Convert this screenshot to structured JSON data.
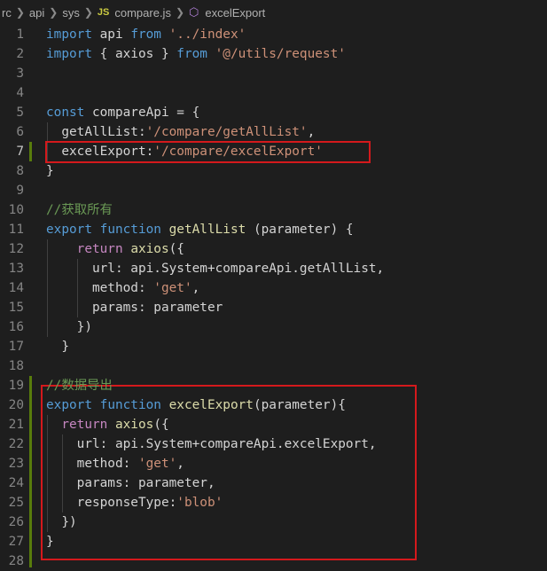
{
  "breadcrumb": {
    "items": [
      "rc",
      "api",
      "sys"
    ],
    "file_badge": "JS",
    "file": "compare.js",
    "symbol": "excelExport"
  },
  "editor": {
    "lines": [
      {
        "n": "1",
        "tokens": [
          [
            "k",
            "import"
          ],
          [
            "p",
            " api "
          ],
          [
            "k",
            "from"
          ],
          [
            "p",
            " "
          ],
          [
            "s",
            "'../index'"
          ]
        ]
      },
      {
        "n": "2",
        "tokens": [
          [
            "k",
            "import"
          ],
          [
            "p",
            " { axios } "
          ],
          [
            "k",
            "from"
          ],
          [
            "p",
            " "
          ],
          [
            "s",
            "'@/utils/request'"
          ]
        ]
      },
      {
        "n": "3",
        "tokens": []
      },
      {
        "n": "4",
        "tokens": []
      },
      {
        "n": "5",
        "tokens": [
          [
            "k",
            "const"
          ],
          [
            "p",
            " compareApi = {"
          ]
        ]
      },
      {
        "n": "6",
        "tokens": [
          [
            "p",
            "  getAllList:"
          ],
          [
            "s",
            "'/compare/getAllList'"
          ],
          [
            "p",
            ","
          ]
        ]
      },
      {
        "n": "7",
        "tokens": [
          [
            "p",
            "  excelExport:"
          ],
          [
            "s",
            "'/compare/excelExport'"
          ]
        ]
      },
      {
        "n": "8",
        "tokens": [
          [
            "p",
            "}"
          ]
        ]
      },
      {
        "n": "9",
        "tokens": []
      },
      {
        "n": "10",
        "tokens": [
          [
            "c",
            "//获取所有"
          ]
        ]
      },
      {
        "n": "11",
        "tokens": [
          [
            "k",
            "export"
          ],
          [
            "p",
            " "
          ],
          [
            "k",
            "function"
          ],
          [
            "p",
            " "
          ],
          [
            "f",
            "getAllList"
          ],
          [
            "p",
            " (parameter) {"
          ]
        ]
      },
      {
        "n": "12",
        "tokens": [
          [
            "p",
            "    "
          ],
          [
            "kc",
            "return"
          ],
          [
            "p",
            " "
          ],
          [
            "f",
            "axios"
          ],
          [
            "p",
            "({"
          ]
        ]
      },
      {
        "n": "13",
        "tokens": [
          [
            "p",
            "      url: api.System+compareApi.getAllList,"
          ]
        ]
      },
      {
        "n": "14",
        "tokens": [
          [
            "p",
            "      method: "
          ],
          [
            "s",
            "'get'"
          ],
          [
            "p",
            ","
          ]
        ]
      },
      {
        "n": "15",
        "tokens": [
          [
            "p",
            "      params: parameter"
          ]
        ]
      },
      {
        "n": "16",
        "tokens": [
          [
            "p",
            "    })"
          ]
        ]
      },
      {
        "n": "17",
        "tokens": [
          [
            "p",
            "  }"
          ]
        ]
      },
      {
        "n": "18",
        "tokens": []
      },
      {
        "n": "19",
        "tokens": [
          [
            "c",
            "//数据导出"
          ]
        ]
      },
      {
        "n": "20",
        "tokens": [
          [
            "k",
            "export"
          ],
          [
            "p",
            " "
          ],
          [
            "k",
            "function"
          ],
          [
            "p",
            " "
          ],
          [
            "f",
            "excelExport"
          ],
          [
            "p",
            "(parameter){"
          ]
        ]
      },
      {
        "n": "21",
        "tokens": [
          [
            "p",
            "  "
          ],
          [
            "kc",
            "return"
          ],
          [
            "p",
            " "
          ],
          [
            "f",
            "axios"
          ],
          [
            "p",
            "({"
          ]
        ]
      },
      {
        "n": "22",
        "tokens": [
          [
            "p",
            "    url: api.System+compareApi.excelExport,"
          ]
        ]
      },
      {
        "n": "23",
        "tokens": [
          [
            "p",
            "    method: "
          ],
          [
            "s",
            "'get'"
          ],
          [
            "p",
            ","
          ]
        ]
      },
      {
        "n": "24",
        "tokens": [
          [
            "p",
            "    params: parameter,"
          ]
        ]
      },
      {
        "n": "25",
        "tokens": [
          [
            "p",
            "    responseType:"
          ],
          [
            "s",
            "'blob'"
          ]
        ]
      },
      {
        "n": "26",
        "tokens": [
          [
            "p",
            "  })"
          ]
        ]
      },
      {
        "n": "27",
        "tokens": [
          [
            "p",
            "}"
          ]
        ]
      },
      {
        "n": "28",
        "tokens": []
      }
    ]
  },
  "colors": {
    "background": "#1e1e1e",
    "keyword": "#569cd6",
    "control_keyword": "#c586c0",
    "string": "#ce9178",
    "function": "#dcdcaa",
    "comment": "#6a9955",
    "highlight_box": "#d4191c",
    "git_modified": "#587c0c"
  }
}
